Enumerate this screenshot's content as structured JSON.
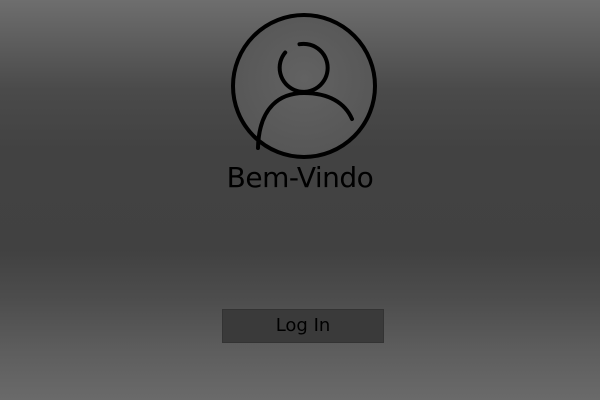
{
  "welcome": {
    "title": "Bem-Vindo"
  },
  "avatar": {
    "icon": "user-icon"
  },
  "actions": {
    "login_label": "Log In"
  },
  "colors": {
    "text": "#000000",
    "button_bg": "#3a3a3a",
    "background_mid": "#414141",
    "avatar_fill": "#5e5e5e"
  }
}
